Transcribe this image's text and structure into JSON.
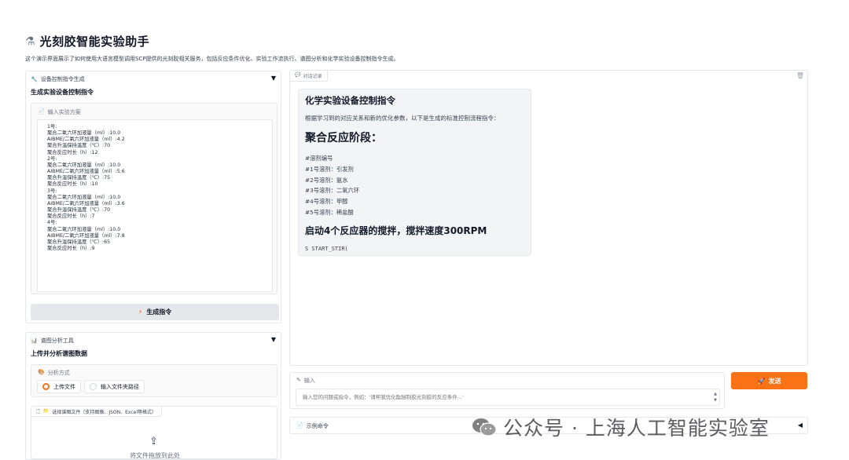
{
  "app": {
    "title": "光刻胶智能实验助手",
    "description": "这个演示界面展示了如何使用大语言模型调用SCP提供的光刻胶相关服务，包括反应条件优化、实验工作流执行、谱图分析和化学实验设备控制指令生成。"
  },
  "device_panel": {
    "header": "设备控制指令生成",
    "toggle": "▼",
    "subtitle": "生成实验设备控制指令",
    "input_label": "输入实验方案",
    "input_lines": [
      "1号:",
      "聚合二氧六环加液量（ml）:10.0",
      "AIBME/二氧六环加液量（ml）:4.2",
      "聚合升温保持温度（℃）:70",
      "聚合反应时长（h）:12",
      "2号:",
      "聚合二氧六环加液量（ml）:10.0",
      "AIBME/二氧六环加液量（ml）:5.6",
      "聚合升温保持温度（℃）:75",
      "聚合反应时长（h）:10",
      "3号:",
      "聚合二氧六环加液量（ml）:10.0",
      "AIBME/二氧六环加液量（ml）:3.6",
      "聚合升温保持温度（℃）:70",
      "聚合反应时长（h）:7",
      "4号:",
      "聚合二氧六环加液量（ml）:10.0",
      "AIBME/二氧六环加液量（ml）:7.8",
      "聚合升温保持温度（℃）:65",
      "聚合反应时长（h）:9"
    ],
    "button_label": "生成指令"
  },
  "spectrum_panel": {
    "header": "谱图分析工具",
    "toggle": "▼",
    "subtitle": "上传并分析谱图数据",
    "method_label": "分析方式",
    "options": [
      "上传文件",
      "输入文件夹路径"
    ],
    "selected_option": "上传文件",
    "upload_label": "选择谱图文件（支持图像、JSON、Excel等格式）",
    "upload_hint": "将文件拖放到此处"
  },
  "chat": {
    "tag": "对话记录",
    "message": {
      "heading": "化学实验设备控制指令",
      "intro": "根据学习到的对应关系和新的优化参数，以下是生成的标准控制流程指令：",
      "section": "聚合反应阶段：",
      "list": [
        "#溶剂编号",
        "#1号溶剂：引发剂",
        "#2号溶剂：氨水",
        "#3号溶剂：二氧六环",
        "#4号溶剂：甲醇",
        "#5号溶剂：稀盐酸"
      ],
      "step_heading": "启动4个反应器的搅拌，搅拌速度300RPM",
      "code": "S START_STIR("
    }
  },
  "input": {
    "label": "输入",
    "placeholder": "输入您的问题或指令，例如：'请帮我优化酯醚制胶光刻胶的反应条件...'"
  },
  "send": {
    "label": "发送"
  },
  "examples": {
    "label": "示例命令",
    "toggle": "◀"
  },
  "watermark": {
    "text": "公众号 · 上海人工智能实验室"
  },
  "colors": {
    "accent": "#f97316",
    "panel_border": "#e5e7eb",
    "message_bg": "#f3f4f6"
  },
  "icons": [
    "flask-icon",
    "wrench-icon",
    "document-icon",
    "lightning-icon",
    "chart-icon",
    "palette-icon",
    "folder-icon",
    "upload-icon",
    "chat-icon",
    "trash-icon",
    "pencil-icon",
    "rocket-icon",
    "wechat-icon"
  ]
}
